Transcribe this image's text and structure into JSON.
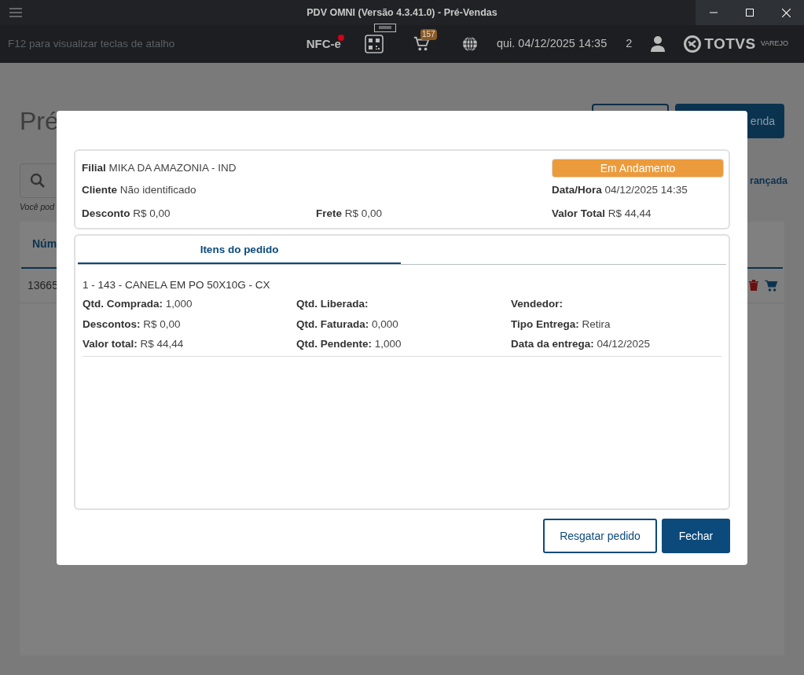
{
  "window": {
    "title": "PDV OMNI (Versão 4.3.41.0) - Pré-Vendas"
  },
  "toolbar": {
    "hint": "F12 para visualizar teclas de atalho",
    "nfce": {
      "label": "NFC-e",
      "alert": true
    },
    "cart_count": "157",
    "datetime": "qui. 04/12/2025 14:35",
    "user_count": "2",
    "logo": {
      "brand": "TOTVS",
      "sub": "VAREJO"
    }
  },
  "background": {
    "title": "Pré",
    "primary_button": "enda",
    "link": "rançada",
    "hint": "Você pod",
    "column": "Núm",
    "cell": "13665"
  },
  "modal": {
    "summary": {
      "rows": [
        [
          {
            "label": "Filial",
            "value": "MIKA DA AMAZONIA - IND"
          },
          null,
          {
            "kind": "status",
            "label": "Em Andamento",
            "color": "#ec9b3c"
          }
        ],
        [
          {
            "label": "Cliente",
            "value": "Não identificado"
          },
          null,
          {
            "label": "Data/Hora",
            "value": "04/12/2025 14:35"
          }
        ],
        [
          {
            "label": "Desconto",
            "value": "R$ 0,00"
          },
          {
            "label": "Frete",
            "value": "R$ 0,00"
          },
          {
            "label": "Valor Total",
            "value": "R$ 44,44"
          }
        ]
      ]
    },
    "tabs": [
      {
        "label": "Itens do pedido",
        "selected": true
      }
    ],
    "items": [
      {
        "title": "1 - 143 - CANELA EM PO 50X10G - CX",
        "columns": [
          [
            {
              "label": "Qtd. Comprada:",
              "value": "1,000"
            },
            {
              "label": "Descontos:",
              "value": "R$ 0,00"
            },
            {
              "label": "Valor total:",
              "value": "R$ 44,44"
            }
          ],
          [
            {
              "label": "Qtd. Liberada:"
            },
            {
              "label": "Qtd. Faturada:",
              "value": "0,000"
            },
            {
              "label": "Qtd. Pendente:",
              "value": "1,000"
            }
          ],
          [
            {
              "label": "Vendedor:"
            },
            {
              "label": "Tipo Entrega:",
              "value": "Retira"
            },
            {
              "label": "Data da entrega:",
              "value": "04/12/2025"
            }
          ]
        ]
      }
    ],
    "buttons": [
      {
        "label": "Resgatar pedido",
        "kind": "outline"
      },
      {
        "label": "Fechar",
        "kind": "primary"
      }
    ]
  }
}
